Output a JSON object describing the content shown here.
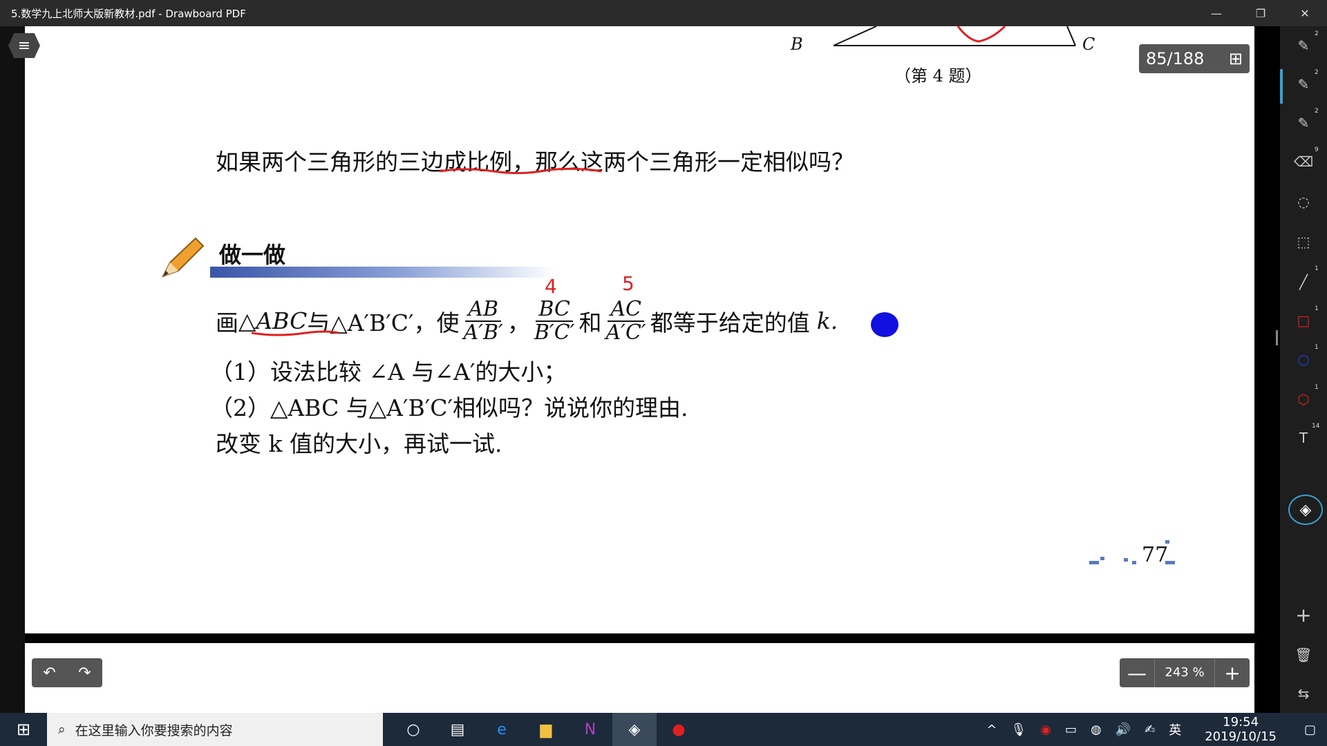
{
  "window": {
    "title": "5.数学九上北师大版新教材.pdf - Drawboard PDF",
    "min": "—",
    "max": "❐",
    "close": "✕"
  },
  "page_counter": {
    "text": "85/188",
    "grid_icon": "grid-icon"
  },
  "figure": {
    "label_b": "B",
    "label_c": "C",
    "caption": "（第 4 题）"
  },
  "question": "如果两个三角形的三边成比例，那么这两个三角形一定相似吗？",
  "activity": {
    "title": "做一做"
  },
  "problem": {
    "line1_a": "画",
    "tri1": "△ABC",
    "line1_b": "与△A′B′C′，使",
    "f1_num": "AB",
    "f1_den": "A′B′",
    "comma": "，",
    "f2_num": "BC",
    "f2_den": "B′C′",
    "he": "和",
    "f3_num": "AC",
    "f3_den": "A′C′",
    "line1_c": "都等于给定的值",
    "k": "k.",
    "q1": "（1）设法比较 ∠A 与∠A′的大小；",
    "q2": "（2）△ABC 与△A′B′C′相似吗？说说你的理由.",
    "q3": "改变 k 值的大小，再试一试."
  },
  "handwriting": {
    "mark1": "4",
    "mark2": "5"
  },
  "page_number": "77",
  "bottom": {
    "undo": "↶",
    "redo": "↷",
    "zoom_minus": "—",
    "zoom_value": "243 %",
    "zoom_plus": "+"
  },
  "right_toolbar": {
    "sup1": "2",
    "sup2": "2",
    "sup3": "2",
    "sup4": "9",
    "sup5": "1",
    "sup6": "1",
    "sup7": "1",
    "sup8": "1",
    "sup9": "14"
  },
  "taskbar": {
    "search_placeholder": "在这里输入你要搜索的内容",
    "ime": "英",
    "time": "19:54",
    "date": "2019/10/15"
  }
}
